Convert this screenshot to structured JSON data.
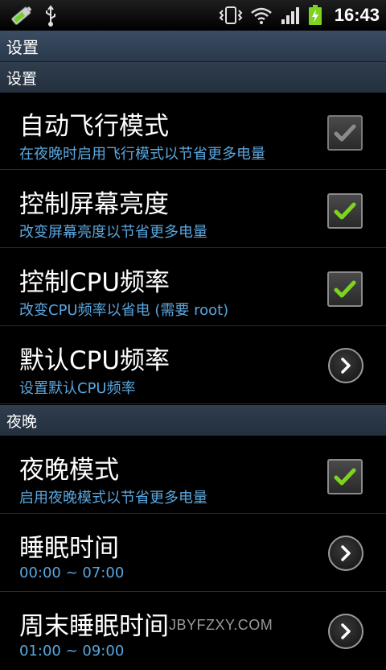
{
  "status_bar": {
    "time": "16:43",
    "icons": [
      "battery-saver-icon",
      "usb-icon",
      "vibrate-icon",
      "wifi-icon",
      "signal-icon",
      "battery-charging-icon"
    ]
  },
  "title_bar": {
    "title": "设置"
  },
  "sections": [
    {
      "header": "设置",
      "items": [
        {
          "title": "自动飞行模式",
          "summary": "在夜晚时启用飞行模式以节省更多电量",
          "widget": "checkbox",
          "checked": true,
          "enabled": false
        },
        {
          "title": "控制屏幕亮度",
          "summary": "改变屏幕亮度以节省更多电量",
          "widget": "checkbox",
          "checked": true,
          "enabled": true
        },
        {
          "title": "控制CPU频率",
          "summary": "改变CPU频率以省电 (需要 root)",
          "widget": "checkbox",
          "checked": true,
          "enabled": true
        },
        {
          "title": "默认CPU频率",
          "summary": "设置默认CPU频率",
          "widget": "arrow"
        }
      ]
    },
    {
      "header": "夜晚",
      "items": [
        {
          "title": "夜晚模式",
          "summary": "启用夜晚模式以节省更多电量",
          "widget": "checkbox",
          "checked": true,
          "enabled": true
        },
        {
          "title": "睡眠时间",
          "summary": "00:00 ~ 07:00",
          "widget": "arrow"
        },
        {
          "title": "周末睡眠时间",
          "summary": "01:00 ~ 09:00",
          "widget": "arrow"
        }
      ]
    }
  ],
  "watermark": "JBYFZXY.COM",
  "colors": {
    "summary": "#5aa7df",
    "check_enabled": "#7ed321",
    "check_disabled": "#8a8a8a"
  }
}
